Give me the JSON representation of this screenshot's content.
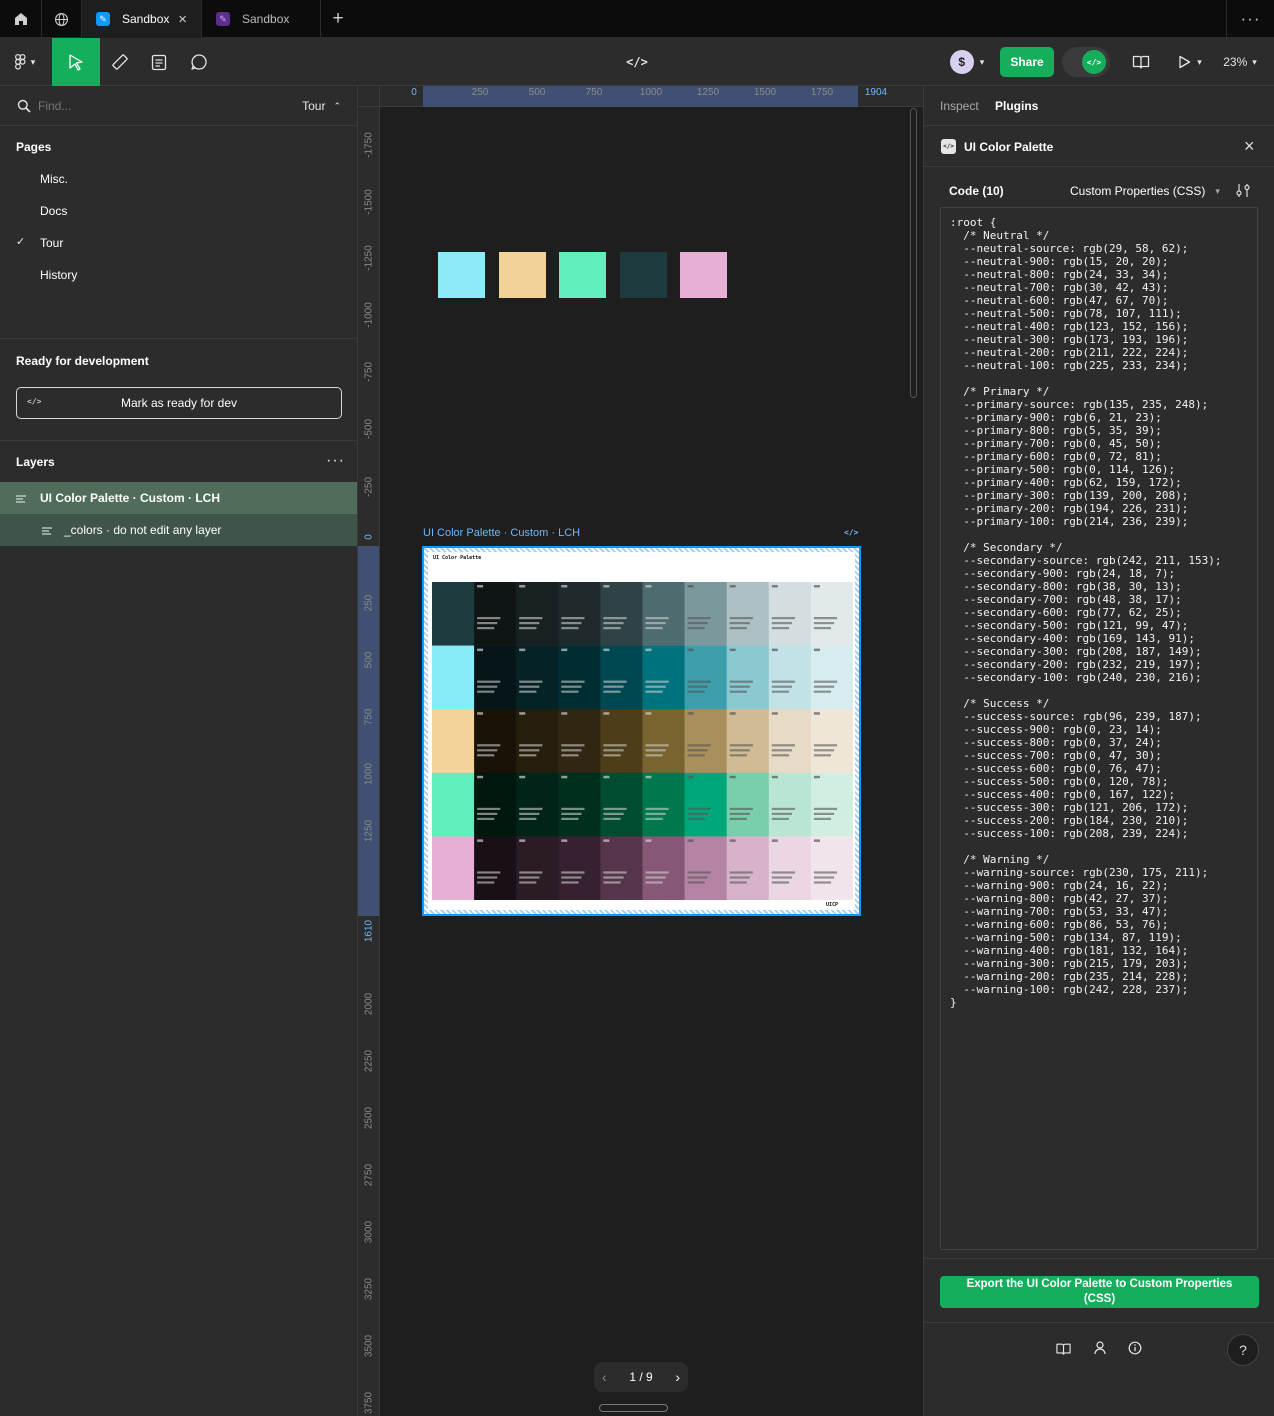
{
  "tabs": [
    {
      "label": "Sandbox",
      "active": true
    },
    {
      "label": "Sandbox",
      "active": false
    }
  ],
  "toolbar": {
    "share_label": "Share",
    "zoom": "23%"
  },
  "left": {
    "search_placeholder": "Find...",
    "page_selector": "Tour",
    "pages_heading": "Pages",
    "pages": [
      {
        "label": "Misc.",
        "checked": false
      },
      {
        "label": "Docs",
        "checked": false
      },
      {
        "label": "Tour",
        "checked": true
      },
      {
        "label": "History",
        "checked": false
      }
    ],
    "ready_heading": "Ready for development",
    "mark_ready_label": "Mark as ready for dev",
    "layers_heading": "Layers",
    "layers": [
      {
        "label": "UI Color Palette · Custom · LCH"
      },
      {
        "label": "_colors · do not edit any layer"
      }
    ]
  },
  "ruler": {
    "h_ticks": [
      "0",
      "250",
      "500",
      "750",
      "1000",
      "1250",
      "1500",
      "1750",
      "1904"
    ],
    "v_ticks": [
      "-1750",
      "-1500",
      "-1250",
      "-1000",
      "-750",
      "-500",
      "-250",
      "0",
      "250",
      "500",
      "750",
      "1000",
      "1250",
      "1610",
      "2000",
      "2250",
      "2500",
      "2750",
      "3000",
      "3250",
      "3500",
      "3750"
    ]
  },
  "canvas": {
    "swatches": [
      "#8eeaf6",
      "#f2d397",
      "#60efbb",
      "#1d3a3e",
      "#e6afd3"
    ],
    "frame_label": "UI Color Palette · Custom · LCH",
    "frame_title": "UI Color Palette",
    "frame_logo": "UICP",
    "pagination": "1 / 9"
  },
  "right": {
    "tabs": [
      "Inspect",
      "Plugins"
    ],
    "plugin_title": "UI Color Palette",
    "code_label": "Code (10)",
    "format": "Custom Properties (CSS)",
    "export_label": "Export the UI Color Palette to Custom Properties (CSS)",
    "code_lines": [
      ":root {",
      "  /* Neutral */",
      "  --neutral-source: rgb(29, 58, 62);",
      "  --neutral-900: rgb(15, 20, 20);",
      "  --neutral-800: rgb(24, 33, 34);",
      "  --neutral-700: rgb(30, 42, 43);",
      "  --neutral-600: rgb(47, 67, 70);",
      "  --neutral-500: rgb(78, 107, 111);",
      "  --neutral-400: rgb(123, 152, 156);",
      "  --neutral-300: rgb(173, 193, 196);",
      "  --neutral-200: rgb(211, 222, 224);",
      "  --neutral-100: rgb(225, 233, 234);",
      "",
      "  /* Primary */",
      "  --primary-source: rgb(135, 235, 248);",
      "  --primary-900: rgb(6, 21, 23);",
      "  --primary-800: rgb(5, 35, 39);",
      "  --primary-700: rgb(0, 45, 50);",
      "  --primary-600: rgb(0, 72, 81);",
      "  --primary-500: rgb(0, 114, 126);",
      "  --primary-400: rgb(62, 159, 172);",
      "  --primary-300: rgb(139, 200, 208);",
      "  --primary-200: rgb(194, 226, 231);",
      "  --primary-100: rgb(214, 236, 239);",
      "",
      "  /* Secondary */",
      "  --secondary-source: rgb(242, 211, 153);",
      "  --secondary-900: rgb(24, 18, 7);",
      "  --secondary-800: rgb(38, 30, 13);",
      "  --secondary-700: rgb(48, 38, 17);",
      "  --secondary-600: rgb(77, 62, 25);",
      "  --secondary-500: rgb(121, 99, 47);",
      "  --secondary-400: rgb(169, 143, 91);",
      "  --secondary-300: rgb(208, 187, 149);",
      "  --secondary-200: rgb(232, 219, 197);",
      "  --secondary-100: rgb(240, 230, 216);",
      "",
      "  /* Success */",
      "  --success-source: rgb(96, 239, 187);",
      "  --success-900: rgb(0, 23, 14);",
      "  --success-800: rgb(0, 37, 24);",
      "  --success-700: rgb(0, 47, 30);",
      "  --success-600: rgb(0, 76, 47);",
      "  --success-500: rgb(0, 120, 78);",
      "  --success-400: rgb(0, 167, 122);",
      "  --success-300: rgb(121, 206, 172);",
      "  --success-200: rgb(184, 230, 210);",
      "  --success-100: rgb(208, 239, 224);",
      "",
      "  /* Warning */",
      "  --warning-source: rgb(230, 175, 211);",
      "  --warning-900: rgb(24, 16, 22);",
      "  --warning-800: rgb(42, 27, 37);",
      "  --warning-700: rgb(53, 33, 47);",
      "  --warning-600: rgb(86, 53, 76);",
      "  --warning-500: rgb(134, 87, 119);",
      "  --warning-400: rgb(181, 132, 164);",
      "  --warning-300: rgb(215, 179, 203);",
      "  --warning-200: rgb(235, 214, 228);",
      "  --warning-100: rgb(242, 228, 237);",
      "}"
    ]
  },
  "palette": [
    {
      "source": "#1d3a3e",
      "shades": [
        "#0f1414",
        "#182122",
        "#1e2a2b",
        "#2f4346",
        "#4e6b6f",
        "#7b989c",
        "#adc1c4",
        "#d3dee0",
        "#e1e9ea"
      ]
    },
    {
      "source": "#87ebf8",
      "shades": [
        "#061517",
        "#052327",
        "#002d32",
        "#004851",
        "#00727e",
        "#3e9fac",
        "#8bc8d0",
        "#c2e2e7",
        "#d6ecef"
      ]
    },
    {
      "source": "#f2d399",
      "shades": [
        "#181207",
        "#261e0d",
        "#302611",
        "#4d3e19",
        "#79632f",
        "#a98f5b",
        "#d0bb95",
        "#e8dbc5",
        "#f0e6d8"
      ]
    },
    {
      "source": "#60efbb",
      "shades": [
        "#00170e",
        "#002518",
        "#002f1e",
        "#004c2f",
        "#00784e",
        "#00a77a",
        "#79ceac",
        "#b8e6d2",
        "#d0efe0"
      ]
    },
    {
      "source": "#e6afd3",
      "shades": [
        "#181016",
        "#2a1b25",
        "#35212f",
        "#56354c",
        "#865777",
        "#b584a4",
        "#d7b3cb",
        "#ebd6e4",
        "#f2e4ed"
      ]
    }
  ],
  "colors": {
    "accent": "#0d99ff",
    "share": "#14ae5c",
    "selected_layer": "#4f6d5a",
    "export": "#14ae5c"
  }
}
